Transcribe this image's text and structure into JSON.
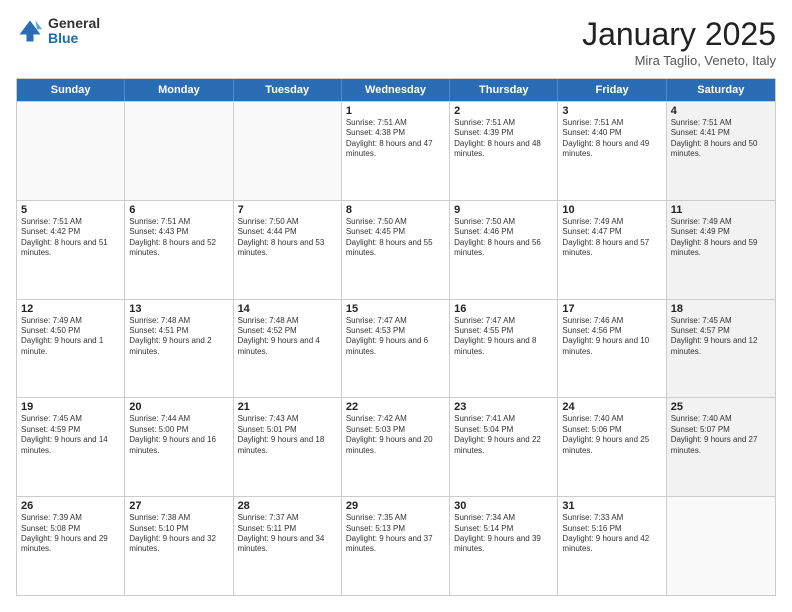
{
  "logo": {
    "general": "General",
    "blue": "Blue"
  },
  "title": "January 2025",
  "subtitle": "Mira Taglio, Veneto, Italy",
  "days": [
    "Sunday",
    "Monday",
    "Tuesday",
    "Wednesday",
    "Thursday",
    "Friday",
    "Saturday"
  ],
  "rows": [
    [
      {
        "day": "",
        "text": "",
        "empty": true
      },
      {
        "day": "",
        "text": "",
        "empty": true
      },
      {
        "day": "",
        "text": "",
        "empty": true
      },
      {
        "day": "1",
        "text": "Sunrise: 7:51 AM\nSunset: 4:38 PM\nDaylight: 8 hours and 47 minutes."
      },
      {
        "day": "2",
        "text": "Sunrise: 7:51 AM\nSunset: 4:39 PM\nDaylight: 8 hours and 48 minutes."
      },
      {
        "day": "3",
        "text": "Sunrise: 7:51 AM\nSunset: 4:40 PM\nDaylight: 8 hours and 49 minutes."
      },
      {
        "day": "4",
        "text": "Sunrise: 7:51 AM\nSunset: 4:41 PM\nDaylight: 8 hours and 50 minutes.",
        "shaded": true
      }
    ],
    [
      {
        "day": "5",
        "text": "Sunrise: 7:51 AM\nSunset: 4:42 PM\nDaylight: 8 hours and 51 minutes."
      },
      {
        "day": "6",
        "text": "Sunrise: 7:51 AM\nSunset: 4:43 PM\nDaylight: 8 hours and 52 minutes."
      },
      {
        "day": "7",
        "text": "Sunrise: 7:50 AM\nSunset: 4:44 PM\nDaylight: 8 hours and 53 minutes."
      },
      {
        "day": "8",
        "text": "Sunrise: 7:50 AM\nSunset: 4:45 PM\nDaylight: 8 hours and 55 minutes."
      },
      {
        "day": "9",
        "text": "Sunrise: 7:50 AM\nSunset: 4:46 PM\nDaylight: 8 hours and 56 minutes."
      },
      {
        "day": "10",
        "text": "Sunrise: 7:49 AM\nSunset: 4:47 PM\nDaylight: 8 hours and 57 minutes."
      },
      {
        "day": "11",
        "text": "Sunrise: 7:49 AM\nSunset: 4:49 PM\nDaylight: 8 hours and 59 minutes.",
        "shaded": true
      }
    ],
    [
      {
        "day": "12",
        "text": "Sunrise: 7:49 AM\nSunset: 4:50 PM\nDaylight: 9 hours and 1 minute."
      },
      {
        "day": "13",
        "text": "Sunrise: 7:48 AM\nSunset: 4:51 PM\nDaylight: 9 hours and 2 minutes."
      },
      {
        "day": "14",
        "text": "Sunrise: 7:48 AM\nSunset: 4:52 PM\nDaylight: 9 hours and 4 minutes."
      },
      {
        "day": "15",
        "text": "Sunrise: 7:47 AM\nSunset: 4:53 PM\nDaylight: 9 hours and 6 minutes."
      },
      {
        "day": "16",
        "text": "Sunrise: 7:47 AM\nSunset: 4:55 PM\nDaylight: 9 hours and 8 minutes."
      },
      {
        "day": "17",
        "text": "Sunrise: 7:46 AM\nSunset: 4:56 PM\nDaylight: 9 hours and 10 minutes."
      },
      {
        "day": "18",
        "text": "Sunrise: 7:45 AM\nSunset: 4:57 PM\nDaylight: 9 hours and 12 minutes.",
        "shaded": true
      }
    ],
    [
      {
        "day": "19",
        "text": "Sunrise: 7:45 AM\nSunset: 4:59 PM\nDaylight: 9 hours and 14 minutes."
      },
      {
        "day": "20",
        "text": "Sunrise: 7:44 AM\nSunset: 5:00 PM\nDaylight: 9 hours and 16 minutes."
      },
      {
        "day": "21",
        "text": "Sunrise: 7:43 AM\nSunset: 5:01 PM\nDaylight: 9 hours and 18 minutes."
      },
      {
        "day": "22",
        "text": "Sunrise: 7:42 AM\nSunset: 5:03 PM\nDaylight: 9 hours and 20 minutes."
      },
      {
        "day": "23",
        "text": "Sunrise: 7:41 AM\nSunset: 5:04 PM\nDaylight: 9 hours and 22 minutes."
      },
      {
        "day": "24",
        "text": "Sunrise: 7:40 AM\nSunset: 5:06 PM\nDaylight: 9 hours and 25 minutes."
      },
      {
        "day": "25",
        "text": "Sunrise: 7:40 AM\nSunset: 5:07 PM\nDaylight: 9 hours and 27 minutes.",
        "shaded": true
      }
    ],
    [
      {
        "day": "26",
        "text": "Sunrise: 7:39 AM\nSunset: 5:08 PM\nDaylight: 9 hours and 29 minutes."
      },
      {
        "day": "27",
        "text": "Sunrise: 7:38 AM\nSunset: 5:10 PM\nDaylight: 9 hours and 32 minutes."
      },
      {
        "day": "28",
        "text": "Sunrise: 7:37 AM\nSunset: 5:11 PM\nDaylight: 9 hours and 34 minutes."
      },
      {
        "day": "29",
        "text": "Sunrise: 7:35 AM\nSunset: 5:13 PM\nDaylight: 9 hours and 37 minutes."
      },
      {
        "day": "30",
        "text": "Sunrise: 7:34 AM\nSunset: 5:14 PM\nDaylight: 9 hours and 39 minutes."
      },
      {
        "day": "31",
        "text": "Sunrise: 7:33 AM\nSunset: 5:16 PM\nDaylight: 9 hours and 42 minutes."
      },
      {
        "day": "",
        "text": "",
        "empty": true,
        "shaded": true
      }
    ]
  ]
}
